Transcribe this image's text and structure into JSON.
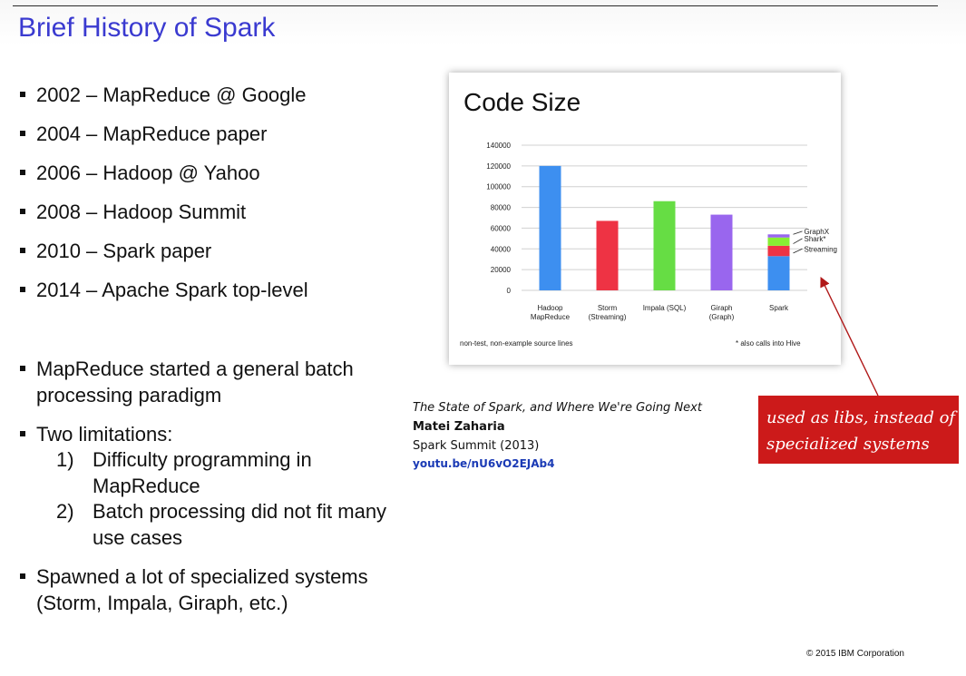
{
  "slide": {
    "title": "Brief History of Spark",
    "timeline": [
      "2002 – MapReduce @ Google",
      "2004 – MapReduce paper",
      "2006 – Hadoop @ Yahoo",
      "2008 – Hadoop Summit",
      "2010 – Spark paper",
      "2014 – Apache Spark top-level"
    ],
    "points": {
      "p1_line1": "MapReduce started a general batch",
      "p1_line2": "processing paradigm",
      "p2": "Two limitations:",
      "sub1_num": "1)",
      "sub1_line1": "Difficulty programming in",
      "sub1_line2": "MapReduce",
      "sub2_num": "2)",
      "sub2_line1": "Batch processing did not fit many",
      "sub2_line2": "use cases",
      "p3_line1": "Spawned a lot of specialized systems",
      "p3_line2": "(Storm, Impala, Giraph, etc.)"
    },
    "citation": {
      "talk": "The State of Spark, and Where We're Going Next",
      "author": "Matei Zaharia",
      "event": "Spark Summit (2013)",
      "link": "youtu.be/nU6vO2EJAb4"
    },
    "callout": {
      "line1": "used as libs, instead of",
      "line2": "specialized systems",
      "color": "#cc1a1a"
    },
    "copyright": "© 2015 IBM  Corporation",
    "title_color": "#3a3ad0"
  },
  "chart_data": {
    "type": "bar",
    "title": "Code Size",
    "categories": [
      "Hadoop MapReduce",
      "Storm (Streaming)",
      "Impala (SQL)",
      "Giraph (Graph)",
      "Spark"
    ],
    "category_lines": [
      [
        "Hadoop",
        "MapReduce"
      ],
      [
        "Storm",
        "(Streaming)"
      ],
      [
        "Impala (SQL)"
      ],
      [
        "Giraph",
        "(Graph)"
      ],
      [
        "Spark"
      ]
    ],
    "values": [
      120000,
      67000,
      86000,
      73000,
      null
    ],
    "bar_colors": [
      "#3d8ff0",
      "#ee3344",
      "#66dd44",
      "#9966ee",
      null
    ],
    "spark_stack": [
      {
        "name": "Streaming",
        "value": 33000,
        "color": "#3d8ff0"
      },
      {
        "name": "Shark*",
        "value": 10000,
        "color": "#ee3344"
      },
      {
        "name": "",
        "value": 8000,
        "color": "#88ee33"
      },
      {
        "name": "GraphX",
        "value": 3000,
        "color": "#9966ee"
      }
    ],
    "annotations": [
      "GraphX",
      "Shark*",
      "Streaming"
    ],
    "yticks": [
      0,
      20000,
      40000,
      60000,
      80000,
      100000,
      120000,
      140000
    ],
    "ylim": [
      0,
      140000
    ],
    "grid": true,
    "footnote_left": "non-test, non-example source lines",
    "footnote_right": "* also calls into Hive"
  }
}
